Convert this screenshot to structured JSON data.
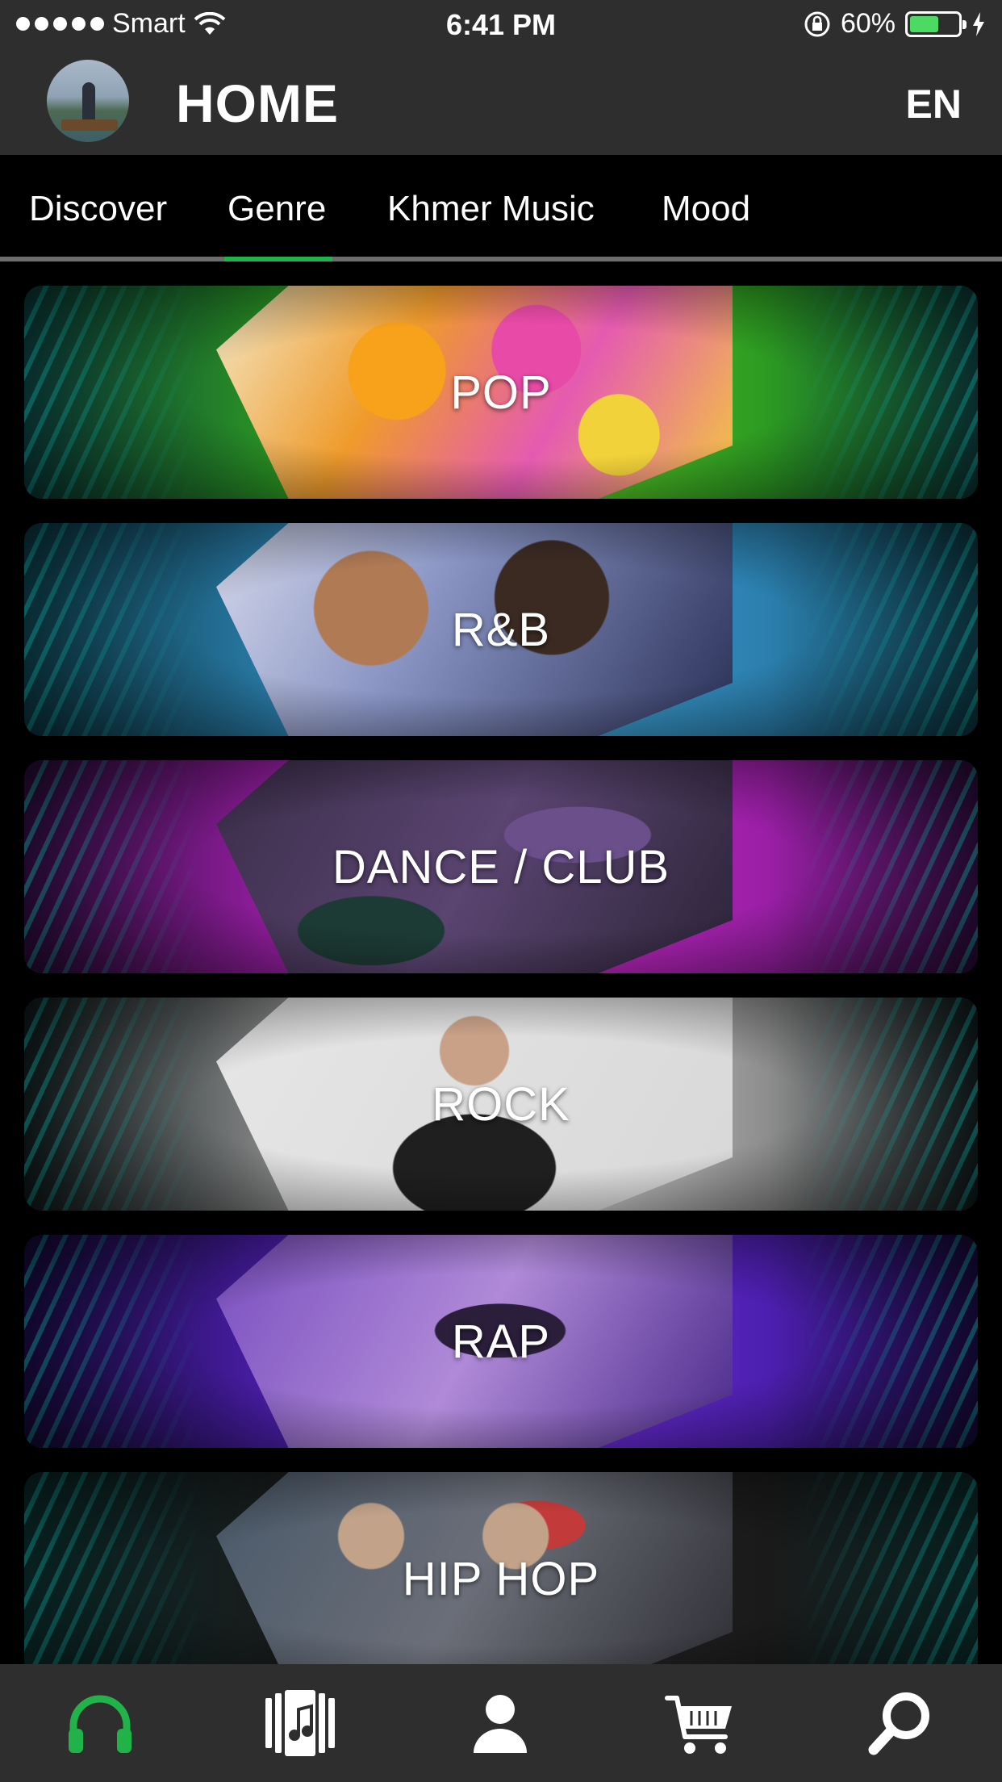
{
  "status_bar": {
    "carrier": "Smart",
    "time": "6:41 PM",
    "battery_percent": "60%",
    "battery_level": 0.6,
    "battery_color": "#4cd964"
  },
  "header": {
    "title": "HOME",
    "language": "EN"
  },
  "tabs": [
    {
      "label": "Discover",
      "active": false
    },
    {
      "label": "Genre",
      "active": true
    },
    {
      "label": "Khmer Music",
      "active": false
    },
    {
      "label": "Mood",
      "active": false
    }
  ],
  "accent_color": "#21b24a",
  "genres": [
    {
      "label": "POP"
    },
    {
      "label": "R&B"
    },
    {
      "label": "DANCE / CLUB"
    },
    {
      "label": "ROCK"
    },
    {
      "label": "RAP"
    },
    {
      "label": "HIP HOP"
    }
  ],
  "bottom_nav": [
    {
      "icon": "headphones-icon",
      "active": true
    },
    {
      "icon": "music-library-icon",
      "active": false
    },
    {
      "icon": "profile-icon",
      "active": false
    },
    {
      "icon": "cart-icon",
      "active": false
    },
    {
      "icon": "search-icon",
      "active": false
    }
  ]
}
